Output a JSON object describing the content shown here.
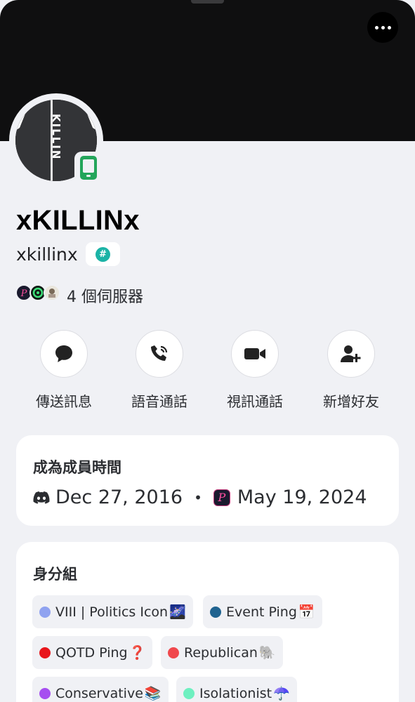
{
  "profile": {
    "display_name": "xKILLINx",
    "username": "xkillinx",
    "tag_symbol": "#",
    "avatar_text": "KILLIN",
    "status": "mobile",
    "mutual_servers": "4 個伺服器"
  },
  "actions": [
    {
      "label": "傳送訊息",
      "icon": "message-bubble-icon"
    },
    {
      "label": "語音通話",
      "icon": "phone-call-icon"
    },
    {
      "label": "視訊通話",
      "icon": "video-camera-icon"
    },
    {
      "label": "新增好友",
      "icon": "add-friend-icon"
    }
  ],
  "member_since": {
    "title": "成為成員時間",
    "discord_date": "Dec 27, 2016",
    "separator": "•",
    "server_date": "May 19, 2024",
    "server_icon_letter": "P"
  },
  "roles": {
    "title": "身分組",
    "items": [
      {
        "name": "VIII | Politics Icon",
        "emoji": "🌌",
        "color": "#8fa2f0"
      },
      {
        "name": "Event Ping",
        "emoji": "📅",
        "color": "#1f6390"
      },
      {
        "name": "QOTD Ping",
        "emoji": "❓",
        "color": "#e8161c"
      },
      {
        "name": "Republican",
        "emoji": "🐘",
        "color": "#f0484d"
      },
      {
        "name": "Conservative",
        "emoji": "📚",
        "color": "#a64ef0"
      },
      {
        "name": "Isolationist",
        "emoji": "☂️",
        "color": "#6ef0c0"
      }
    ]
  },
  "colors": {
    "banner": "#0f0f10",
    "background": "#f0f1f5",
    "online_green": "#23a55a",
    "tag_teal": "#1bb3a6"
  }
}
